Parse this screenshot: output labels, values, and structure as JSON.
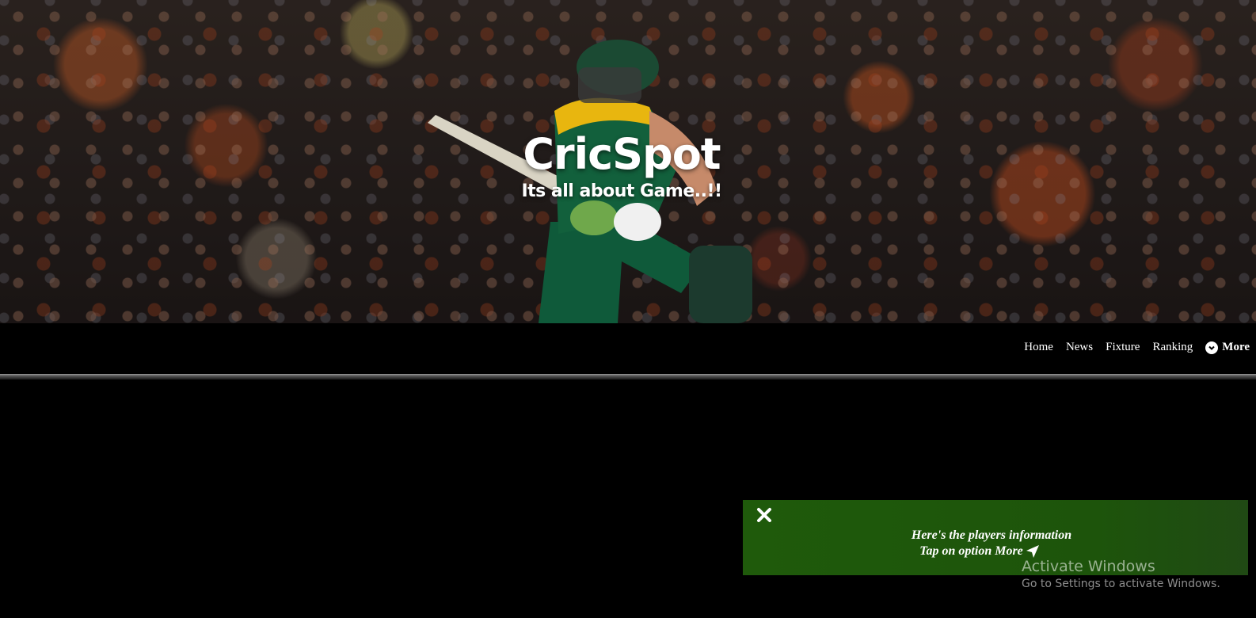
{
  "hero": {
    "title": "CricSpot",
    "subtitle": "Its all about Game..!!"
  },
  "nav": {
    "items": [
      "Home",
      "News",
      "Fixture",
      "Ranking"
    ],
    "more_label": "More",
    "more_icon": "chevron-circle-down-icon"
  },
  "toast": {
    "line1": "Here's the players information",
    "line2": "Tap on option More",
    "close_icon": "close-icon",
    "arrow_icon": "send-arrow-icon",
    "background": "#1f5a0b"
  },
  "watermark": {
    "title": "Activate Windows",
    "subtitle": "Go to Settings to activate Windows."
  }
}
